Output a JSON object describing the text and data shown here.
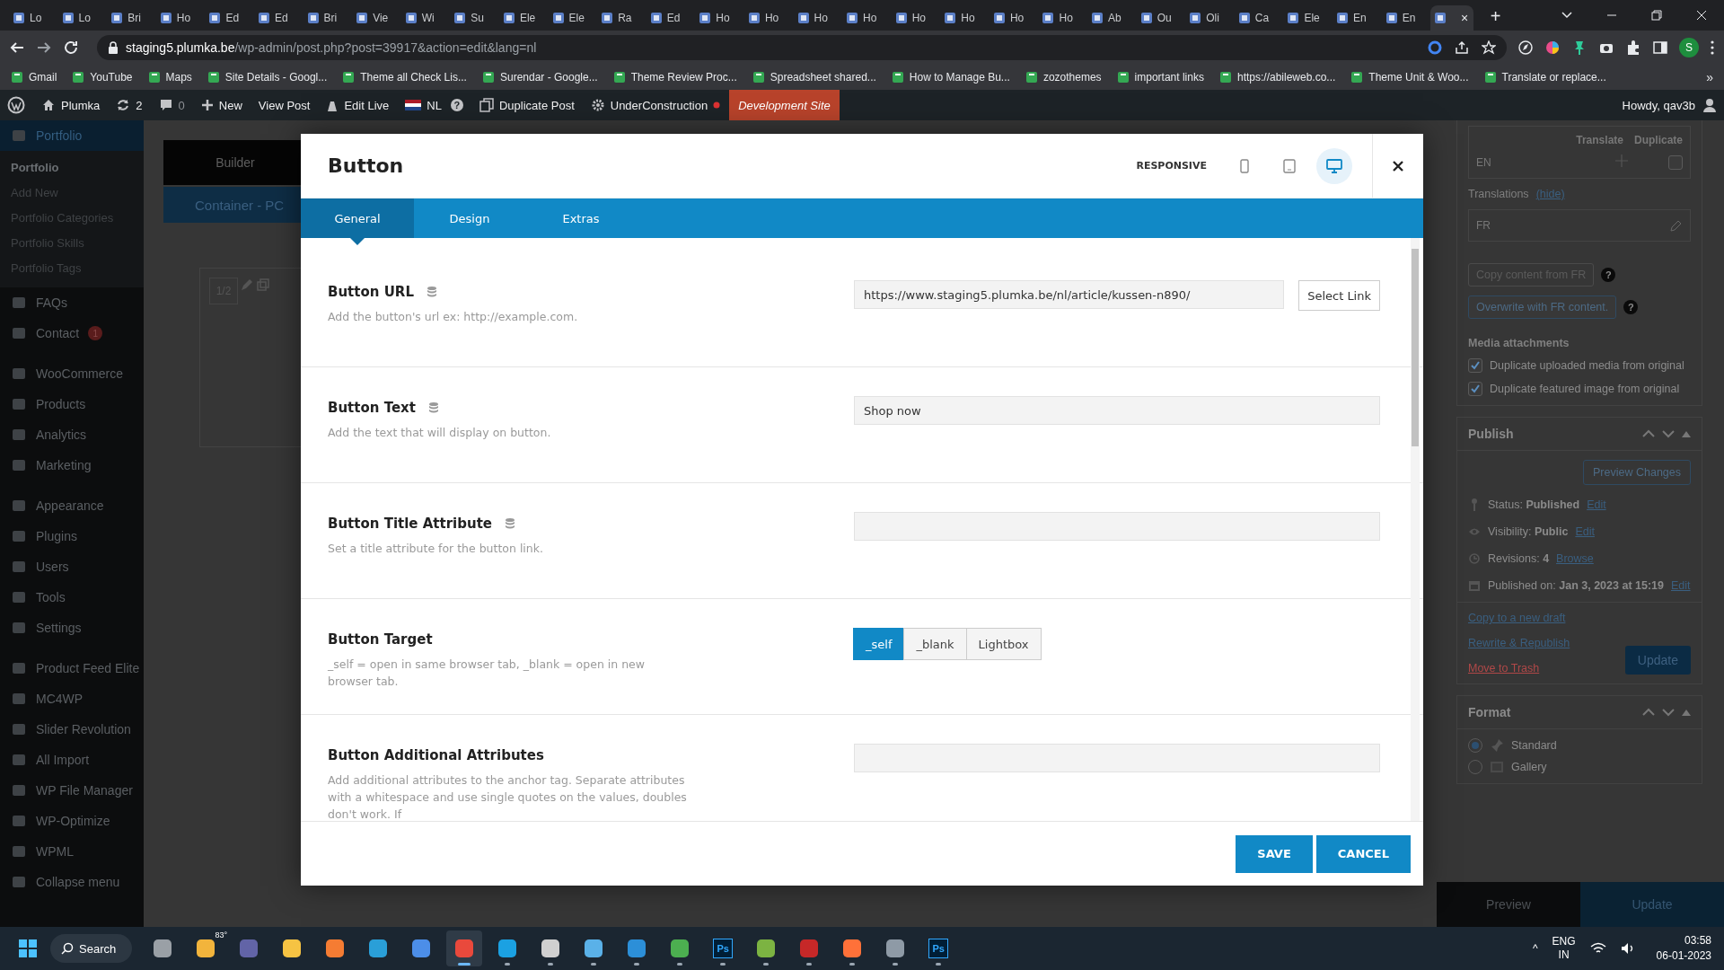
{
  "browser": {
    "tabs": [
      {
        "label": "Lo",
        "selected": false
      },
      {
        "label": "Lo",
        "selected": false
      },
      {
        "label": "Bri",
        "selected": false
      },
      {
        "label": "Ho",
        "selected": false
      },
      {
        "label": "Ed",
        "selected": false
      },
      {
        "label": "Ed",
        "selected": false
      },
      {
        "label": "Bri",
        "selected": false
      },
      {
        "label": "Vie",
        "selected": false
      },
      {
        "label": "Wi",
        "selected": false
      },
      {
        "label": "Su",
        "selected": false
      },
      {
        "label": "Ele",
        "selected": false
      },
      {
        "label": "Ele",
        "selected": false
      },
      {
        "label": "Ra",
        "selected": false
      },
      {
        "label": "Ed",
        "selected": false
      },
      {
        "label": "Ho",
        "selected": false
      },
      {
        "label": "Ho",
        "selected": false
      },
      {
        "label": "Ho",
        "selected": false
      },
      {
        "label": "Ho",
        "selected": false
      },
      {
        "label": "Ho",
        "selected": false
      },
      {
        "label": "Ho",
        "selected": false
      },
      {
        "label": "Ho",
        "selected": false
      },
      {
        "label": "Ho",
        "selected": false
      },
      {
        "label": "Ab",
        "selected": false
      },
      {
        "label": "Ou",
        "selected": false
      },
      {
        "label": "Oli",
        "selected": false
      },
      {
        "label": "Ca",
        "selected": false
      },
      {
        "label": "Ele",
        "selected": false
      },
      {
        "label": "En",
        "selected": false
      },
      {
        "label": "En",
        "selected": false
      },
      {
        "selected": true,
        "close": "×"
      }
    ],
    "new_tab": "+",
    "address": {
      "host": "staging5.plumka.be",
      "path": "/wp-admin/post.php?post=39917&action=edit&lang=nl"
    },
    "profile": "S",
    "bookmarks": [
      "Gmail",
      "YouTube",
      "Maps",
      "Site Details - Googl...",
      "Theme all Check Lis...",
      "Surendar - Google...",
      "Theme Review Proc...",
      "Spreadsheet shared...",
      "How to Manage Bu...",
      "zozothemes",
      "important links",
      "https://abileweb.co...",
      "Theme Unit & Woo...",
      "Translate or replace..."
    ],
    "bookmarks_more": "»"
  },
  "admin_bar": {
    "site": "Plumka",
    "updates": "2",
    "comments": "0",
    "new": "New",
    "view_post": "View Post",
    "edit_live": "Edit Live",
    "language": "NL",
    "help": "?",
    "duplicate": "Duplicate Post",
    "construction": "UnderConstruction",
    "dev_label": "Development Site",
    "greeting": "Howdy, qav3b"
  },
  "sidebar": {
    "groups": [
      [
        {
          "label": "Portfolio",
          "selected": true,
          "children": [
            {
              "label": "Portfolio",
              "selected": true
            },
            {
              "label": "Add New",
              "selected": false
            },
            {
              "label": "Portfolio Categories",
              "selected": false
            },
            {
              "label": "Portfolio Skills",
              "selected": false
            },
            {
              "label": "Portfolio Tags",
              "selected": false
            }
          ]
        },
        {
          "label": "FAQs",
          "selected": false
        },
        {
          "label": "Contact",
          "selected": false,
          "badge": "1"
        }
      ],
      [
        {
          "label": "WooCommerce",
          "selected": false
        },
        {
          "label": "Products",
          "selected": false
        },
        {
          "label": "Analytics",
          "selected": false
        },
        {
          "label": "Marketing",
          "selected": false
        }
      ],
      [
        {
          "label": "Appearance",
          "selected": false
        },
        {
          "label": "Plugins",
          "selected": false
        },
        {
          "label": "Users",
          "selected": false
        },
        {
          "label": "Tools",
          "selected": false
        },
        {
          "label": "Settings",
          "selected": false
        }
      ],
      [
        {
          "label": "Product Feed Elite",
          "selected": false
        },
        {
          "label": "MC4WP",
          "selected": false
        },
        {
          "label": "Slider Revolution",
          "selected": false
        },
        {
          "label": "All Import",
          "selected": false
        },
        {
          "label": "WP File Manager",
          "selected": false
        },
        {
          "label": "WP-Optimize",
          "selected": false
        },
        {
          "label": "WPML",
          "selected": false
        },
        {
          "label": "Collapse menu",
          "selected": false
        }
      ]
    ]
  },
  "builder": {
    "tab": "Builder",
    "container": "Container - PC",
    "column_size": "1/2"
  },
  "right_panel": {
    "lang_table": {
      "headers": [
        "Translate",
        "Duplicate"
      ],
      "rows": [
        {
          "language": "EN",
          "duplicate": false
        }
      ]
    },
    "translations_label": "Translations",
    "hide_link": "(hide)",
    "translation_row": "FR",
    "copy_button": "Copy content from FR",
    "overwrite_button": "Overwrite with FR content.",
    "help_marks": [
      "?",
      "?"
    ],
    "media_heading": "Media attachments",
    "media_options": [
      {
        "label": "Duplicate uploaded media from original",
        "checked": true
      },
      {
        "label": "Duplicate featured image from original",
        "checked": true
      }
    ],
    "publish": {
      "title": "Publish",
      "preview_button": "Preview Changes",
      "meta": [
        {
          "kind": "status",
          "text": "Status: **Published**",
          "link": "Edit"
        },
        {
          "kind": "visibility",
          "text": "Visibility: **Public**",
          "link": "Edit"
        },
        {
          "kind": "revisions",
          "text": "Revisions: **4**",
          "link": "Browse"
        },
        {
          "kind": "date",
          "text": "Published on: **Jan 3, 2023 at 15:19**",
          "link": "Edit"
        }
      ],
      "actions": [
        "Copy to a new draft",
        "Rewrite & Republish"
      ],
      "trash": "Move to Trash",
      "update": "Update"
    },
    "format": {
      "title": "Format",
      "options": [
        {
          "kind": "standard",
          "label": "Standard",
          "selected": true
        },
        {
          "kind": "gallery",
          "label": "Gallery",
          "selected": false
        }
      ]
    },
    "bottom_bar": {
      "preview": "Preview",
      "update": "Update"
    }
  },
  "modal": {
    "title": "Button",
    "responsive_label": "RESPONSIVE",
    "devices": [
      {
        "kind": "mobile",
        "selected": false
      },
      {
        "kind": "tablet",
        "selected": false
      },
      {
        "kind": "desktop",
        "selected": true
      }
    ],
    "tabs": [
      {
        "label": "General",
        "selected": true
      },
      {
        "label": "Design",
        "selected": false
      },
      {
        "label": "Extras",
        "selected": false
      }
    ],
    "fields": [
      {
        "kind": "text",
        "label": "Button URL",
        "dynamic": true,
        "description": "Add the button's url ex: http://example.com.",
        "value": "https://www.staging5.plumka.be/nl/article/kussen-n890/",
        "button": "Select Link"
      },
      {
        "kind": "text",
        "label": "Button Text",
        "dynamic": true,
        "description": "Add the text that will display on button.",
        "value": "Shop now"
      },
      {
        "kind": "text",
        "label": "Button Title Attribute",
        "dynamic": true,
        "description": "Set a title attribute for the button link."
      },
      {
        "kind": "choice",
        "label": "Button Target",
        "dynamic": false,
        "description": "_self = open in same browser tab, _blank = open in new browser tab.",
        "options": [
          {
            "label": "_self",
            "selected": true
          },
          {
            "label": "_blank",
            "selected": false
          },
          {
            "label": "Lightbox",
            "selected": false
          }
        ]
      },
      {
        "kind": "text",
        "label": "Button Additional Attributes",
        "dynamic": false,
        "description": "Add additional attributes to the anchor tag. Separate attributes with a whitespace and use single quotes on the values, doubles don't work. If"
      }
    ],
    "save": "SAVE",
    "cancel": "CANCEL"
  },
  "taskbar": {
    "search": "Search",
    "weather": "83°",
    "apps": [
      {
        "kind": "tile",
        "color": "#9aa0a6",
        "running": false,
        "selected": false
      },
      {
        "kind": "tile",
        "color": "#f2b43c",
        "running": false,
        "selected": false
      },
      {
        "kind": "tile",
        "color": "#6264a7",
        "running": false,
        "selected": false
      },
      {
        "kind": "tile",
        "color": "#f6c343",
        "running": false,
        "selected": false
      },
      {
        "kind": "tile",
        "color": "#f57c33",
        "running": false,
        "selected": false
      },
      {
        "kind": "tile",
        "color": "#2a9fd8",
        "running": false,
        "selected": false
      },
      {
        "kind": "tile",
        "color": "#4c8ee8",
        "running": false,
        "selected": false
      },
      {
        "kind": "tile",
        "color": "#e9493c",
        "running": true,
        "selected": true
      },
      {
        "kind": "tile",
        "color": "#1ba1e2",
        "running": true,
        "selected": false
      },
      {
        "kind": "tile",
        "color": "#d0d0d0",
        "running": true,
        "selected": false
      },
      {
        "kind": "tile",
        "color": "#5ab1e8",
        "running": true,
        "selected": false
      },
      {
        "kind": "tile",
        "color": "#2c8fd8",
        "running": true,
        "selected": false
      },
      {
        "kind": "tile",
        "color": "#4caf50",
        "running": true,
        "selected": false
      },
      {
        "kind": "text",
        "label": "Ps",
        "color": "#31a8ff",
        "running": true,
        "selected": false
      },
      {
        "kind": "tile",
        "color": "#7cb342",
        "running": true,
        "selected": false
      },
      {
        "kind": "tile",
        "color": "#c62828",
        "running": true,
        "selected": false
      },
      {
        "kind": "tile",
        "color": "#ff7139",
        "running": true,
        "selected": false
      },
      {
        "kind": "tile",
        "color": "#8e9aa6",
        "running": true,
        "selected": false
      },
      {
        "kind": "text",
        "label": "Ps",
        "color": "#31a8ff",
        "running": true,
        "selected": false
      }
    ],
    "tray_expand": "^",
    "language": "ENG",
    "region": "IN",
    "time": "03:58",
    "date": "06-01-2023"
  }
}
